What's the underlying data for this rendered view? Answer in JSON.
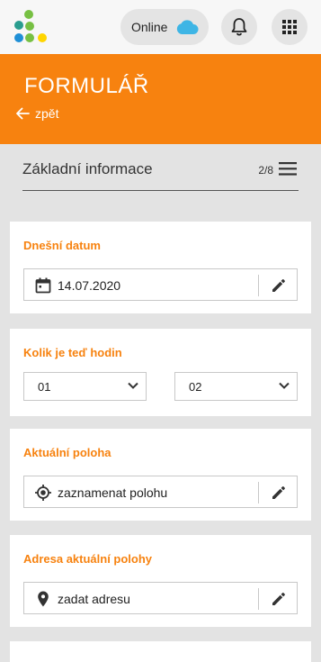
{
  "topbar": {
    "status_label": "Online",
    "icons": [
      "logo-dots",
      "cloud-icon",
      "bell-icon",
      "apps-grid-icon"
    ],
    "colors": {
      "accent": "#f7820f",
      "cloud": "#3eb5e5",
      "logo_green": "#77c043",
      "logo_teal": "#2a9d8f",
      "logo_blue": "#1f8fd6",
      "logo_yellow": "#ffd500"
    }
  },
  "header": {
    "title": "FORMULÁŘ",
    "back_label": "zpět"
  },
  "section": {
    "title": "Základní informace",
    "step": "2/8"
  },
  "form": {
    "date": {
      "label": "Dnešní datum",
      "value": "14.07.2020",
      "icon": "calendar-icon"
    },
    "time": {
      "label": "Kolik je teď hodin",
      "hours": "01",
      "minutes": "02"
    },
    "location": {
      "label": "Aktuální poloha",
      "value": "zaznamenat polohu",
      "icon": "gps-target-icon"
    },
    "address": {
      "label": "Adresa aktuální polohy",
      "value": "zadat adresu",
      "icon": "map-pin-icon"
    }
  }
}
